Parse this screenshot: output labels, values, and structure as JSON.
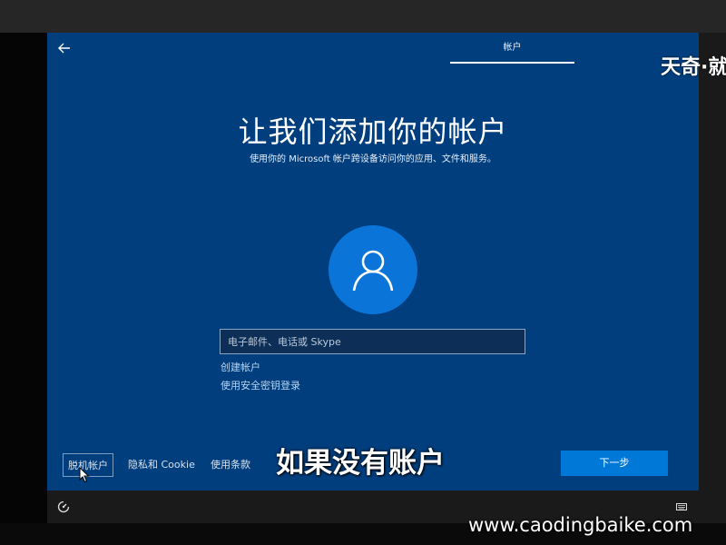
{
  "header": {
    "tab_label": "帐户"
  },
  "page": {
    "title": "让我们添加你的帐户",
    "subtitle": "使用你的 Microsoft 帐户跨设备访问你的应用、文件和服务。"
  },
  "sign_in": {
    "email_placeholder": "电子邮件、电话或 Skype",
    "email_value": "",
    "create_account_link": "创建帐户",
    "security_key_link": "使用安全密钥登录"
  },
  "footer": {
    "offline_account": "脱机帐户",
    "privacy_cookie": "隐私和 Cookie",
    "terms_of_use": "使用条款",
    "next_button": "下一步"
  },
  "overlay": {
    "caption": "如果没有账户",
    "watermark_top": "天奇·就",
    "watermark_bottom": "www.caodingbaike.com"
  },
  "icons": {
    "back": "back-arrow-icon",
    "avatar": "user-icon",
    "ease_of_access": "ease-of-access-icon",
    "keyboard": "keyboard-icon",
    "cursor": "mouse-pointer-icon"
  },
  "colors": {
    "oobe_background": "#003e7e",
    "accent": "#0078d7",
    "avatar_circle": "#0a74d8",
    "link": "#b8d6f5"
  }
}
